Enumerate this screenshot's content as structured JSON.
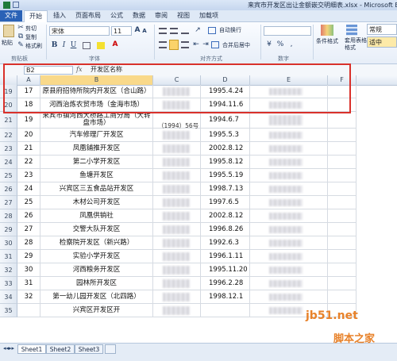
{
  "window": {
    "title": "来宾市开发区出让金额嵌交明细表.xlsx - Microsoft Ex"
  },
  "tabs": [
    "文件",
    "开始",
    "插入",
    "页面布局",
    "公式",
    "数据",
    "审阅",
    "视图",
    "加载项"
  ],
  "ribbon": {
    "paste": "粘贴",
    "cut": "剪切",
    "copy": "复制",
    "format_painter": "格式刷",
    "font_name": "宋体",
    "font_size": "11",
    "bold": "B",
    "italic": "I",
    "underline": "U",
    "wrap_text": "自动换行",
    "merge_center": "合并后居中",
    "number_format": "常规",
    "percent": "%",
    "comma": ",",
    "cond_format": "条件格式",
    "table_format": "套用表格格式",
    "style_normal": "常规",
    "style_good": "适中",
    "groups": {
      "clipboard": "剪贴板",
      "font": "字体",
      "alignment": "对齐方式",
      "number": "数字"
    }
  },
  "formula_bar": {
    "cell_ref": "B2",
    "fx": "fx",
    "content": "开发区名称"
  },
  "columns": [
    "A",
    "B",
    "C",
    "D",
    "E",
    "F"
  ],
  "rows": [
    {
      "row": "19",
      "a": "17",
      "b": "原县府招待所院内开发区（合山路）",
      "d": "1995.4.24"
    },
    {
      "row": "20",
      "a": "18",
      "b": "河西治炼农贸市场（金海市场）",
      "d": "1994.11.6"
    },
    {
      "row": "21",
      "a": "19",
      "b": "来宾市镇河西大桥路工商分局（大转盘市场）",
      "c": "（1994）56号",
      "d": "1994.6.7"
    },
    {
      "row": "22",
      "a": "20",
      "b": "汽车修理厂开发区",
      "d": "1995.5.3"
    },
    {
      "row": "23",
      "a": "21",
      "b": "凤凰铺推开发区",
      "d": "2002.8.12"
    },
    {
      "row": "24",
      "a": "22",
      "b": "第二小学开发区",
      "d": "1995.8.12"
    },
    {
      "row": "25",
      "a": "23",
      "b": "鱼塘开发区",
      "d": "1995.5.19"
    },
    {
      "row": "26",
      "a": "24",
      "b": "兴宾区三五食品站开发区",
      "d": "1998.7.13"
    },
    {
      "row": "27",
      "a": "25",
      "b": "木材公司开发区",
      "d": "1997.6.5"
    },
    {
      "row": "28",
      "a": "26",
      "b": "凤凰供销社",
      "d": "2002.8.12"
    },
    {
      "row": "29",
      "a": "27",
      "b": "交警大队开发区",
      "d": "1996.8.26"
    },
    {
      "row": "30",
      "a": "28",
      "b": "检察院开发区（新兴路）",
      "d": "1992.6.3"
    },
    {
      "row": "31",
      "a": "29",
      "b": "实验小学开发区",
      "d": "1996.1.11"
    },
    {
      "row": "32",
      "a": "30",
      "b": "河西粮务开发区",
      "d": "1995.11.20"
    },
    {
      "row": "33",
      "a": "31",
      "b": "园林所开发区",
      "d": "1996.2.28"
    },
    {
      "row": "34",
      "a": "32",
      "b": "第一幼儿园开发区（北四路）",
      "d": "1998.12.1"
    },
    {
      "row": "35",
      "a": "",
      "b": "兴宾区开发区开",
      "d": ""
    }
  ],
  "sheets": [
    "Sheet1",
    "Sheet2",
    "Sheet3"
  ],
  "watermark": {
    "line1": "jb51.net",
    "line2": "脚本之家"
  }
}
